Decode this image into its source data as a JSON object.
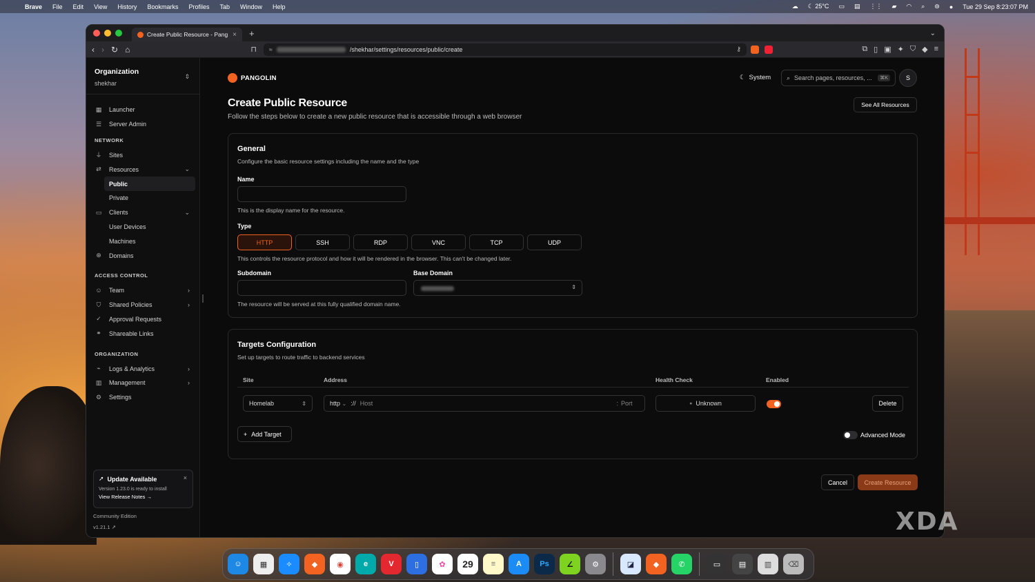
{
  "menubar": {
    "app": "Brave",
    "items": [
      "File",
      "Edit",
      "View",
      "History",
      "Bookmarks",
      "Profiles",
      "Tab",
      "Window",
      "Help"
    ],
    "weather": "25°C",
    "datetime": "Tue 29 Sep  8:23:07 PM"
  },
  "browser": {
    "tab_title": "Create Public Resource - Pang",
    "url_path": "/shekhar/settings/resources/public/create"
  },
  "sidebar": {
    "org_title": "Organization",
    "org_name": "shekhar",
    "launcher": "Launcher",
    "server_admin": "Server Admin",
    "network_heading": "NETWORK",
    "sites": "Sites",
    "resources": "Resources",
    "public": "Public",
    "private": "Private",
    "clients": "Clients",
    "user_devices": "User Devices",
    "machines": "Machines",
    "domains": "Domains",
    "access_heading": "ACCESS CONTROL",
    "team": "Team",
    "shared_policies": "Shared Policies",
    "approval_requests": "Approval Requests",
    "shareable_links": "Shareable Links",
    "org_heading": "ORGANIZATION",
    "logs": "Logs & Analytics",
    "management": "Management",
    "settings": "Settings",
    "update_title": "Update Available",
    "update_version": "Version 1.23.0 is ready to install",
    "update_link": "View Release Notes →",
    "edition": "Community Edition",
    "version": "v1.21.1"
  },
  "header": {
    "brand": "PANGOLIN",
    "theme": "System",
    "search_placeholder": "Search pages, resources, ...",
    "search_shortcut": "⌘K",
    "avatar": "S"
  },
  "page": {
    "title": "Create Public Resource",
    "subtitle": "Follow the steps below to create a new public resource that is accessible through a web browser",
    "see_all": "See All Resources"
  },
  "general": {
    "title": "General",
    "subtitle": "Configure the basic resource settings including the name and the type",
    "name_label": "Name",
    "name_value": "",
    "name_help": "This is the display name for the resource.",
    "type_label": "Type",
    "types": [
      "HTTP",
      "SSH",
      "RDP",
      "VNC",
      "TCP",
      "UDP"
    ],
    "selected_type": "HTTP",
    "type_help": "This controls the resource protocol and how it will be rendered in the browser. This can't be changed later.",
    "subdomain_label": "Subdomain",
    "subdomain_value": "",
    "base_domain_label": "Base Domain",
    "domain_help": "The resource will be served at this fully qualified domain name."
  },
  "targets": {
    "title": "Targets Configuration",
    "subtitle": "Set up targets to route traffic to backend services",
    "col_site": "Site",
    "col_address": "Address",
    "col_health": "Health Check",
    "col_enabled": "Enabled",
    "site_value": "Homelab",
    "scheme": "http",
    "scheme_sep": "://",
    "host_placeholder": "Host",
    "port_placeholder": "Port",
    "port_sep": ":",
    "health_value": "Unknown",
    "delete": "Delete",
    "add_target": "Add Target",
    "advanced_mode": "Advanced Mode"
  },
  "actions": {
    "cancel": "Cancel",
    "create": "Create Resource"
  },
  "dock": {
    "calendar_day": "29"
  },
  "watermark": "XDA",
  "colors": {
    "accent": "#f26322",
    "background": "#0b0b0c"
  }
}
